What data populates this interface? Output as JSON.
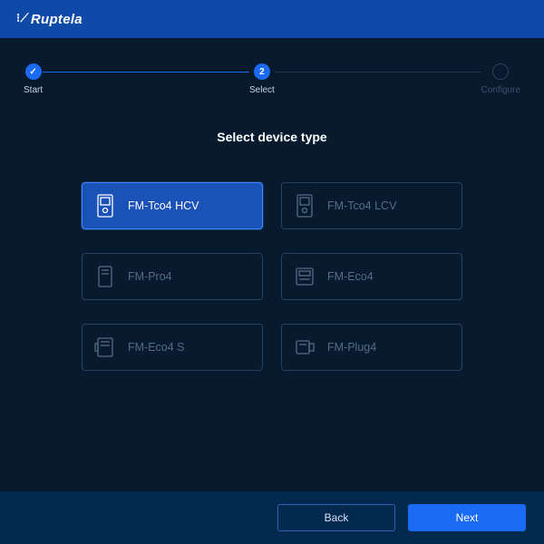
{
  "brand": "Ruptela",
  "stepper": {
    "steps": [
      {
        "label": "Start",
        "state": "done",
        "mark": "✓"
      },
      {
        "label": "Select",
        "state": "active",
        "mark": "2"
      },
      {
        "label": "Configure",
        "state": "pending",
        "mark": ""
      }
    ]
  },
  "title": "Select device type",
  "devices": [
    {
      "name": "FM-Tco4 HCV",
      "selected": true,
      "icon": "device-a"
    },
    {
      "name": "FM-Tco4 LCV",
      "selected": false,
      "icon": "device-a"
    },
    {
      "name": "FM-Pro4",
      "selected": false,
      "icon": "device-b"
    },
    {
      "name": "FM-Eco4",
      "selected": false,
      "icon": "device-c"
    },
    {
      "name": "FM-Eco4 S",
      "selected": false,
      "icon": "device-d"
    },
    {
      "name": "FM-Plug4",
      "selected": false,
      "icon": "device-e"
    }
  ],
  "footer": {
    "back": "Back",
    "next": "Next"
  }
}
